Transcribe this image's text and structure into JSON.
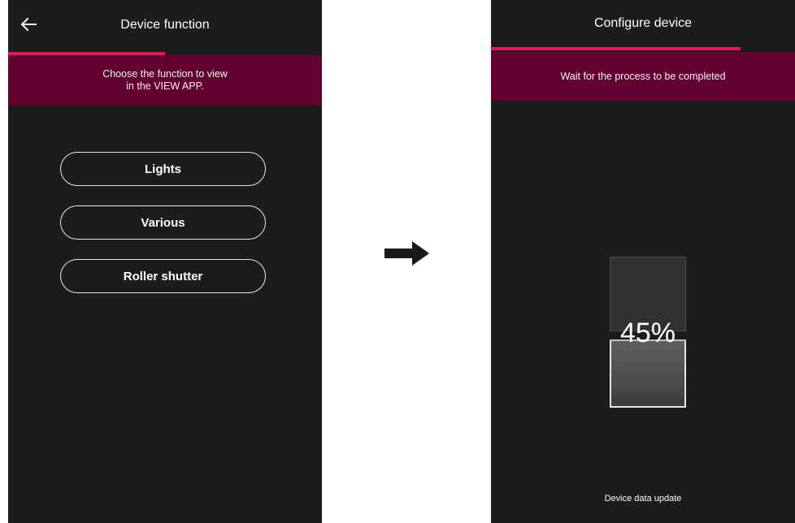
{
  "left_screen": {
    "title": "Device function",
    "back_icon": "arrow-left-icon",
    "progress": 0.5,
    "banner_text": "Choose the function to view\nin the VIEW APP.",
    "options": [
      "Lights",
      "Various",
      "Roller shutter"
    ]
  },
  "transition_icon": "arrow-right-icon",
  "right_screen": {
    "title": "Configure device",
    "progress": 0.82,
    "banner_text": "Wait for the process to be completed",
    "progress_percent": "45%",
    "progress_value": 0.45,
    "status_text": "Device data update"
  },
  "colors": {
    "background": "#1c1c1c",
    "accent": "#e5185a",
    "banner": "#61012f",
    "text": "#ffffff"
  }
}
